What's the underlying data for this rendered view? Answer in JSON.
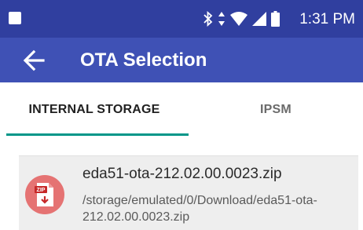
{
  "status_bar": {
    "time": "1:31 PM",
    "icons": [
      "bluetooth-icon",
      "data-transfer-icon",
      "wifi-icon",
      "cell-signal-icon",
      "battery-icon"
    ]
  },
  "app_bar": {
    "title": "OTA Selection",
    "back_icon": "arrow-back-icon",
    "background_color": "#3f51b5",
    "status_color": "#303f9f"
  },
  "tabs": [
    {
      "label": "INTERNAL STORAGE",
      "selected": true
    },
    {
      "label": "IPSM",
      "selected": false
    }
  ],
  "tab_indicator_color": "#009688",
  "files": [
    {
      "name": "eda51-ota-212.02.00.0023.zip",
      "path": "/storage/emulated/0/Download/eda51-ota-212.02.00.0023.zip",
      "icon": "zip-file-icon",
      "icon_label": "ZIP",
      "icon_color": "#e57373"
    }
  ]
}
